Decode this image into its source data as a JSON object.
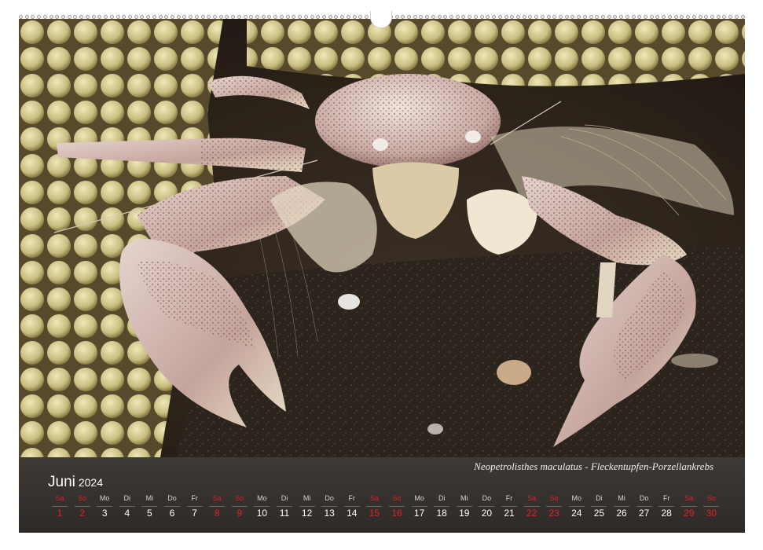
{
  "photo": {
    "subject": "porcelain-crab",
    "caption": "Neopetrolisthes maculatus - Fleckentupfen-Porzellankrebs"
  },
  "calendar": {
    "month": "Juni",
    "year": "2024",
    "days": [
      {
        "wd": "Sa",
        "num": "1",
        "weekend": true
      },
      {
        "wd": "So",
        "num": "2",
        "weekend": true
      },
      {
        "wd": "Mo",
        "num": "3",
        "weekend": false
      },
      {
        "wd": "Di",
        "num": "4",
        "weekend": false
      },
      {
        "wd": "Mi",
        "num": "5",
        "weekend": false
      },
      {
        "wd": "Do",
        "num": "6",
        "weekend": false
      },
      {
        "wd": "Fr",
        "num": "7",
        "weekend": false
      },
      {
        "wd": "Sa",
        "num": "8",
        "weekend": true
      },
      {
        "wd": "So",
        "num": "9",
        "weekend": true
      },
      {
        "wd": "Mo",
        "num": "10",
        "weekend": false
      },
      {
        "wd": "Di",
        "num": "11",
        "weekend": false
      },
      {
        "wd": "Mi",
        "num": "12",
        "weekend": false
      },
      {
        "wd": "Do",
        "num": "13",
        "weekend": false
      },
      {
        "wd": "Fr",
        "num": "14",
        "weekend": false
      },
      {
        "wd": "Sa",
        "num": "15",
        "weekend": true
      },
      {
        "wd": "So",
        "num": "16",
        "weekend": true
      },
      {
        "wd": "Mo",
        "num": "17",
        "weekend": false
      },
      {
        "wd": "Di",
        "num": "18",
        "weekend": false
      },
      {
        "wd": "Mi",
        "num": "19",
        "weekend": false
      },
      {
        "wd": "Do",
        "num": "20",
        "weekend": false
      },
      {
        "wd": "Fr",
        "num": "21",
        "weekend": false
      },
      {
        "wd": "Sa",
        "num": "22",
        "weekend": true
      },
      {
        "wd": "So",
        "num": "23",
        "weekend": true
      },
      {
        "wd": "Mo",
        "num": "24",
        "weekend": false
      },
      {
        "wd": "Di",
        "num": "25",
        "weekend": false
      },
      {
        "wd": "Mi",
        "num": "26",
        "weekend": false
      },
      {
        "wd": "Do",
        "num": "27",
        "weekend": false
      },
      {
        "wd": "Fr",
        "num": "28",
        "weekend": false
      },
      {
        "wd": "Sa",
        "num": "29",
        "weekend": true
      },
      {
        "wd": "So",
        "num": "30",
        "weekend": true
      }
    ]
  },
  "colors": {
    "weekend": "#e0202a",
    "panel": "#3a3532",
    "tentacle": "#d8cf94"
  }
}
